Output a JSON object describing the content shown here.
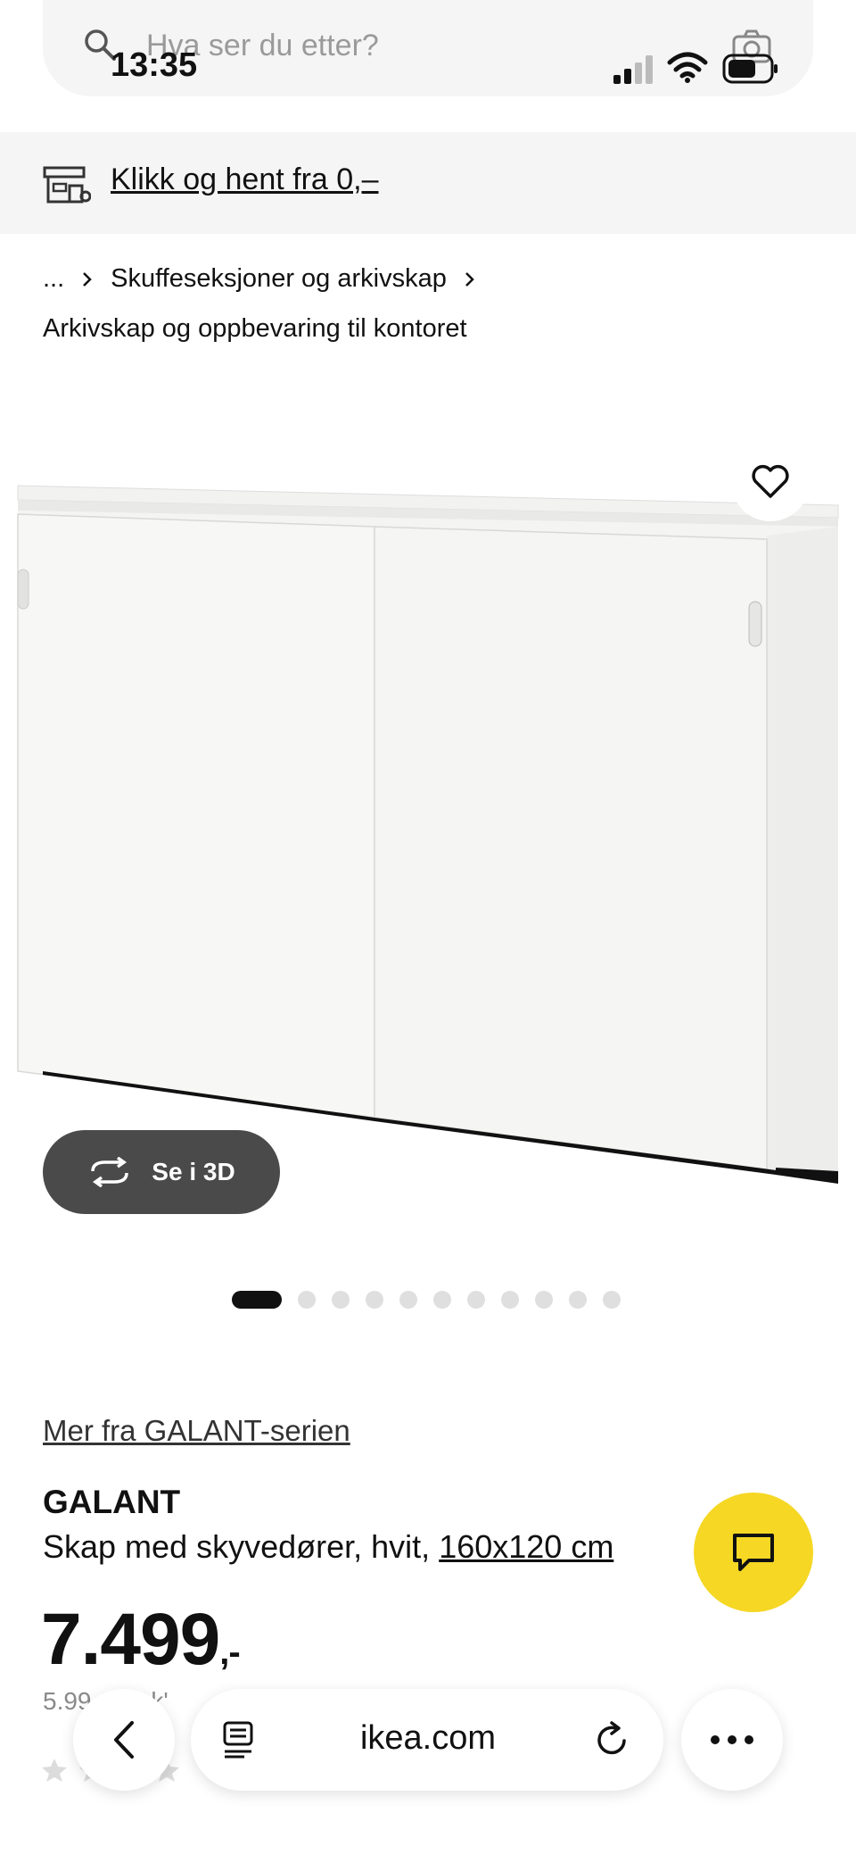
{
  "status_bar": {
    "time": "13:35"
  },
  "search": {
    "placeholder": "Hva ser du etter?"
  },
  "banner": {
    "click_collect_label": "Klikk og hent fra 0,–"
  },
  "breadcrumb": {
    "ellipsis": "...",
    "level_1": "Skuffeseksjoner og arkivskap",
    "level_2": "Arkivskap og oppbevaring til kontoret"
  },
  "gallery": {
    "view_3d_label": "Se i 3D",
    "dot_count": 11,
    "active_index": 0
  },
  "product": {
    "series_link": "Mer fra GALANT-serien",
    "name": "GALANT",
    "description": "Skap med skyvedører, hvit,",
    "size_link": "160x120 cm",
    "price": "7.499",
    "price_suffix": ",-",
    "price_sub": "5.99_ eksk'"
  },
  "browser": {
    "url": "ikea.com"
  },
  "colors": {
    "accent_yellow": "#f5d724",
    "dark_button": "#4a4a4a",
    "panel_gray": "#f5f5f5"
  },
  "icons": [
    "search-icon",
    "camera-icon",
    "signal-icon",
    "wifi-icon",
    "battery-icon",
    "store-icon",
    "chevron-right-icon",
    "heart-icon",
    "rotate-3d-icon",
    "chat-icon",
    "chevron-left-icon",
    "reader-icon",
    "reload-icon",
    "more-icon",
    "star-icon"
  ]
}
